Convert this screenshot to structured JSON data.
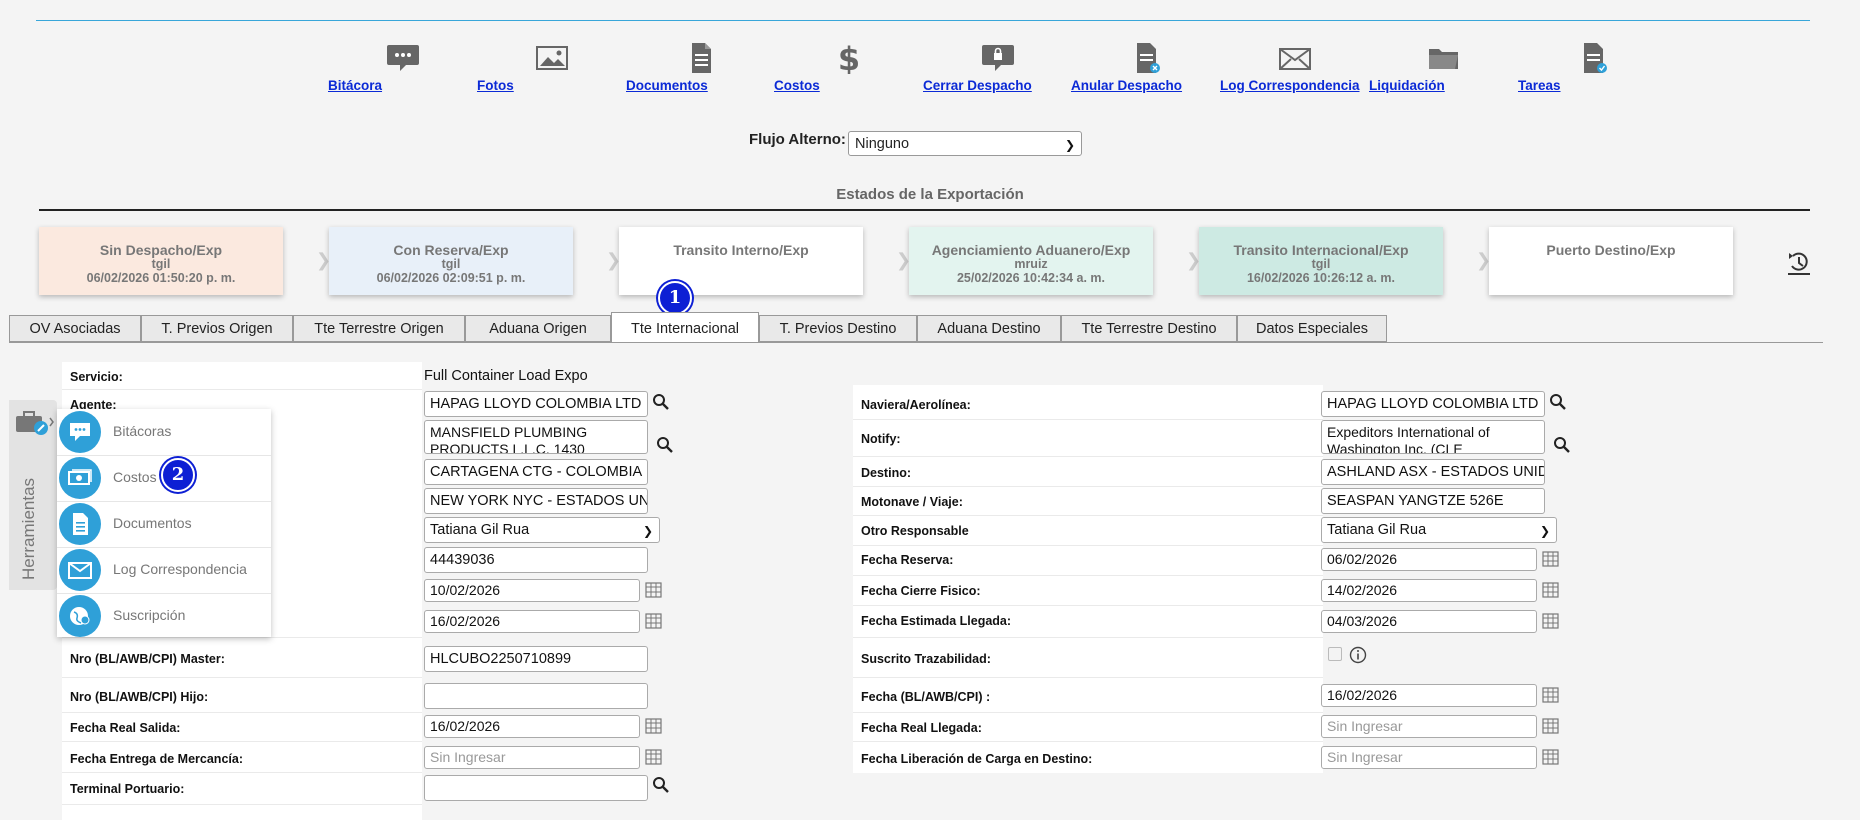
{
  "toolbar": {
    "items": [
      {
        "label": "Bitácora",
        "icon": "chat-icon"
      },
      {
        "label": "Fotos",
        "icon": "image-icon"
      },
      {
        "label": "Documentos",
        "icon": "document-icon"
      },
      {
        "label": "Costos",
        "icon": "dollar-icon"
      },
      {
        "label": "Cerrar Despacho",
        "icon": "lock-chat-icon"
      },
      {
        "label": "Anular Despacho",
        "icon": "document-cancel-icon"
      },
      {
        "label": "Log Correspondencia",
        "icon": "envelope-icon"
      },
      {
        "label": "Liquidación",
        "icon": "folder-icon"
      },
      {
        "label": "Tareas",
        "icon": "document-check-icon"
      }
    ]
  },
  "flujo": {
    "label": "Flujo Alterno:",
    "value": "Ninguno"
  },
  "estados": {
    "title": "Estados de la Exportación",
    "cards": [
      {
        "name": "Sin Despacho/Exp",
        "user": "tgil",
        "date": "06/02/2026 01:50:20 p. m.",
        "color": "#fbe9df"
      },
      {
        "name": "Con Reserva/Exp",
        "user": "tgil",
        "date": "06/02/2026 02:09:51 p. m.",
        "color": "#e8f0f9"
      },
      {
        "name": "Transito Interno/Exp",
        "user": "",
        "date": "",
        "color": "#ffffff"
      },
      {
        "name": "Agenciamiento Aduanero/Exp",
        "user": "mruiz",
        "date": "25/02/2026 10:42:34 a. m.",
        "color": "#e3f4ef"
      },
      {
        "name": "Transito Internacional/Exp",
        "user": "tgil",
        "date": "16/02/2026 10:26:12 a. m.",
        "color": "#cdeae3"
      },
      {
        "name": "Puerto Destino/Exp",
        "user": "",
        "date": "",
        "color": "#ffffff"
      }
    ]
  },
  "badges": {
    "one": "1",
    "two": "2"
  },
  "tabs": [
    "OV Asociadas",
    "T. Previos Origen",
    "Tte Terrestre Origen",
    "Aduana Origen",
    "Tte Internacional",
    "T. Previos Destino",
    "Aduana Destino",
    "Tte Terrestre Destino",
    "Datos Especiales"
  ],
  "form_left": {
    "servicio_label": "Servicio:",
    "servicio_value": "Full Container Load Expo",
    "agente_label": "Agente:",
    "agente_value": "HAPAG LLOYD COLOMBIA LTD",
    "shipper_value": "MANSFIELD PLUMBING PRODUCTS L.L.C. 1430",
    "origen_value": "CARTAGENA CTG - COLOMBIA",
    "puerto_value": "NEW YORK NYC - ESTADOS UNIDOS",
    "responsable_value": "Tatiana Gil Rua",
    "booking_value": "44439036",
    "fecha1_value": "10/02/2026",
    "fecha2_value": "16/02/2026",
    "master_label": "Nro (BL/AWB/CPI) Master:",
    "master_value": "HLCUBO2250710899",
    "hijo_label": "Nro (BL/AWB/CPI) Hijo:",
    "hijo_value": "",
    "real_salida_label": "Fecha Real Salida:",
    "real_salida_value": "16/02/2026",
    "entrega_label": "Fecha Entrega de Mercancía:",
    "entrega_placeholder": "Sin Ingresar",
    "terminal_label": "Terminal Portuario:",
    "terminal_value": ""
  },
  "form_right": {
    "naviera_label": "Naviera/Aerolínea:",
    "naviera_value": "HAPAG LLOYD COLOMBIA LTD",
    "notify_label": "Notify:",
    "notify_value": "Expeditors International of Washington Inc. (CLE",
    "destino_label": "Destino:",
    "destino_value": "ASHLAND ASX - ESTADOS UNIDOS",
    "motonave_label": "Motonave / Viaje:",
    "motonave_value": "SEASPAN YANGTZE 526E",
    "otro_label": "Otro Responsable",
    "otro_value": "Tatiana Gil Rua",
    "reserva_label": "Fecha Reserva:",
    "reserva_value": "06/02/2026",
    "cierre_label": "Fecha Cierre Fisico:",
    "cierre_value": "14/02/2026",
    "estimada_label": "Fecha Estimada Llegada:",
    "estimada_value": "04/03/2026",
    "suscrito_label": "Suscrito Trazabilidad:",
    "fecha_bl_label": "Fecha (BL/AWB/CPI) :",
    "fecha_bl_value": "16/02/2026",
    "real_llegada_label": "Fecha Real Llegada:",
    "real_llegada_placeholder": "Sin Ingresar",
    "liberacion_label": "Fecha Liberación de Carga en Destino:",
    "liberacion_placeholder": "Sin Ingresar"
  },
  "herramientas": {
    "title": "Herramientas",
    "items": [
      "Bitácoras",
      "Costos",
      "Documentos",
      "Log Correspondencia",
      "Suscripción"
    ]
  }
}
